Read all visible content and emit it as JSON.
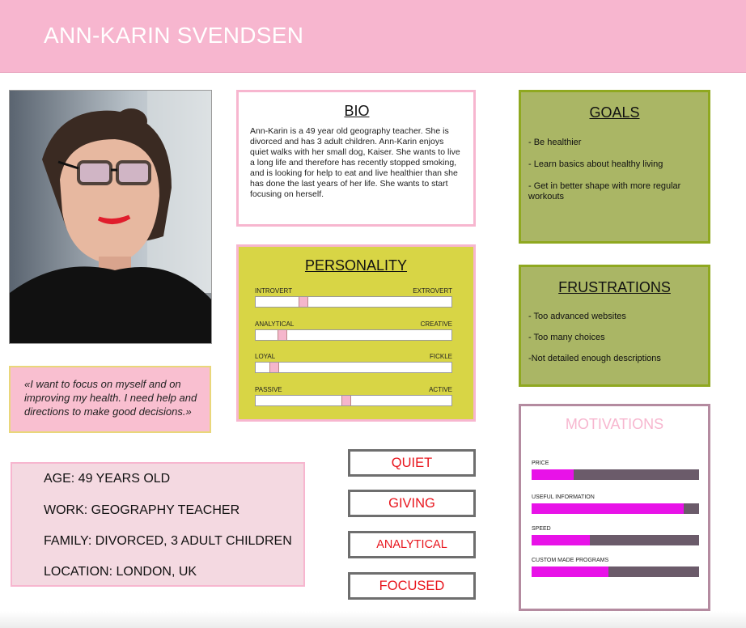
{
  "header": {
    "name": "ANN-KARIN SVENDSEN"
  },
  "quote": "«I want to focus on myself and on improving my health. I need help and directions to make good decisions.»",
  "bio": {
    "title": "BIO",
    "text": "Ann-Karin is a 49 year old geography teacher. She is divorced and has 3 adult children. Ann-Karin enjoys quiet walks with her small dog, Kaiser. She wants to live a long life and therefore has recently stopped smoking, and is looking for help to eat and live healthier than she has done the last years of her life. She wants to start focusing on herself."
  },
  "personality": {
    "title": "PERSONALITY",
    "sliders": [
      {
        "left": "INTROVERT",
        "right": "EXTROVERT",
        "value": 0.22
      },
      {
        "left": "ANALYTICAL",
        "right": "CREATIVE",
        "value": 0.11
      },
      {
        "left": "LOYAL",
        "right": "FICKLE",
        "value": 0.07
      },
      {
        "left": "PASSIVE",
        "right": "ACTIVE",
        "value": 0.44
      }
    ]
  },
  "goals": {
    "title": "GOALS",
    "items": [
      "- Be healthier",
      "- Learn basics about healthy living",
      "- Get in better shape with more regular workouts"
    ]
  },
  "frustrations": {
    "title": "FRUSTRATIONS",
    "items": [
      "- Too advanced websites",
      "- Too many choices",
      "-Not detailed enough descriptions"
    ]
  },
  "motivations": {
    "title": "MOTIVATIONS",
    "bars": [
      {
        "label": "PRICE",
        "value": 0.25
      },
      {
        "label": "USEFUL INFORMATION",
        "value": 0.91
      },
      {
        "label": "SPEED",
        "value": 0.35
      },
      {
        "label": "CUSTOM MADE PROGRAMS",
        "value": 0.46
      }
    ]
  },
  "info": {
    "age": "AGE: 49 YEARS OLD",
    "work": "WORK: GEOGRAPHY TEACHER",
    "family": "FAMILY: DIVORCED, 3 ADULT CHILDREN",
    "location": "LOCATION: LONDON, UK"
  },
  "traits": [
    "QUIET",
    "GIVING",
    "ANALYTICAL",
    "FOCUSED"
  ],
  "colors": {
    "header": "#f7b6cf",
    "personality_bg": "#d8d545",
    "goals_bg": "#aab665",
    "motivation_fill": "#e812e8",
    "motivation_track": "#6b5b6a",
    "trait_text": "#e8141c"
  }
}
